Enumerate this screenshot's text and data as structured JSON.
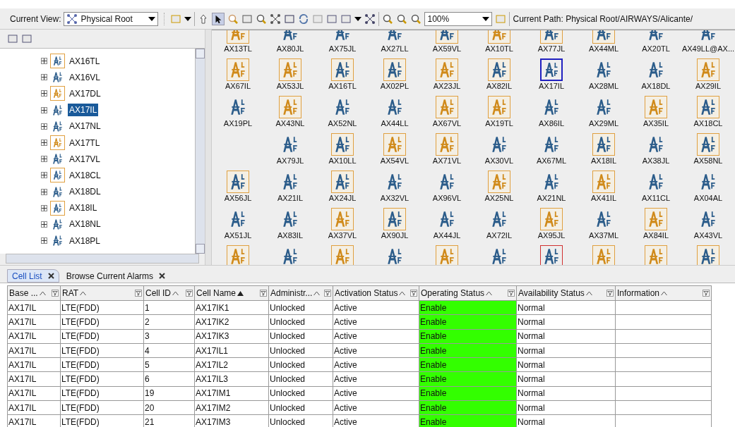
{
  "toolbar": {
    "view_label": "Current View:",
    "view_value": "Physical Root",
    "zoom_value": "100%",
    "path": "Current Path: Physical Root/AIRWAYS/Alicante/"
  },
  "tree": {
    "items": [
      {
        "label": "AX16TL",
        "framed": true,
        "color": "#2b5c8a",
        "selected": false
      },
      {
        "label": "AX16VL",
        "framed": false,
        "color": "#2b5c8a",
        "selected": false
      },
      {
        "label": "AX17DL",
        "framed": true,
        "color": "#d08a1a",
        "selected": false
      },
      {
        "label": "AX17IL",
        "framed": false,
        "color": "#2b5c8a",
        "selected": true
      },
      {
        "label": "AX17NL",
        "framed": false,
        "color": "#2b5c8a",
        "selected": false
      },
      {
        "label": "AX17TL",
        "framed": true,
        "color": "#d08a1a",
        "selected": false
      },
      {
        "label": "AX17VL",
        "framed": false,
        "color": "#2b5c8a",
        "selected": false
      },
      {
        "label": "AX18CL",
        "framed": true,
        "color": "#2b5c8a",
        "selected": false
      },
      {
        "label": "AX18DL",
        "framed": false,
        "color": "#2b5c8a",
        "selected": false
      },
      {
        "label": "AX18IL",
        "framed": true,
        "color": "#2b5c8a",
        "selected": false
      },
      {
        "label": "AX18NL",
        "framed": false,
        "color": "#2b5c8a",
        "selected": false
      },
      {
        "label": "AX18PL",
        "framed": false,
        "color": "#2b5c8a",
        "selected": false
      }
    ]
  },
  "map": {
    "rows": [
      [
        {
          "label": "AX13TL",
          "framed": true,
          "alarm": false,
          "color": "#d08a1a",
          "selected": false
        },
        {
          "label": "AX80JL",
          "framed": false,
          "alarm": false,
          "color": "#2b5c8a",
          "selected": false
        },
        {
          "label": "AX75JL",
          "framed": false,
          "alarm": false,
          "color": "#2b5c8a",
          "selected": false
        },
        {
          "label": "AX27LL",
          "framed": false,
          "alarm": false,
          "color": "#2b5c8a",
          "selected": false
        },
        {
          "label": "AX59VL",
          "framed": true,
          "alarm": false,
          "color": "#2b5c8a",
          "selected": false
        },
        {
          "label": "AX10TL",
          "framed": true,
          "alarm": false,
          "color": "#d08a1a",
          "selected": false
        },
        {
          "label": "AX77JL",
          "framed": true,
          "alarm": false,
          "color": "#2b5c8a",
          "selected": false
        },
        {
          "label": "AX44ML",
          "framed": true,
          "alarm": false,
          "color": "#2b5c8a",
          "selected": false
        },
        {
          "label": "AX20TL",
          "framed": false,
          "alarm": false,
          "color": "#2b5c8a",
          "selected": false
        },
        {
          "label": "AX49LL@AX...",
          "framed": false,
          "alarm": false,
          "color": "#2b5c8a",
          "selected": false
        }
      ],
      [
        {
          "label": "AX67IL",
          "framed": true,
          "alarm": false,
          "color": "#d08a1a",
          "selected": false
        },
        {
          "label": "AX53JL",
          "framed": true,
          "alarm": false,
          "color": "#d08a1a",
          "selected": false
        },
        {
          "label": "AX16TL",
          "framed": true,
          "alarm": false,
          "color": "#2b5c8a",
          "selected": false
        },
        {
          "label": "AX02PL",
          "framed": true,
          "alarm": false,
          "color": "#2b5c8a",
          "selected": false
        },
        {
          "label": "AX23JL",
          "framed": true,
          "alarm": false,
          "color": "#d08a1a",
          "selected": false
        },
        {
          "label": "AX82IL",
          "framed": true,
          "alarm": false,
          "color": "#2b5c8a",
          "selected": false
        },
        {
          "label": "AX17IL",
          "framed": false,
          "alarm": false,
          "color": "#2b5c8a",
          "selected": true
        },
        {
          "label": "AX28ML",
          "framed": false,
          "alarm": false,
          "color": "#2b5c8a",
          "selected": false
        },
        {
          "label": "AX18DL",
          "framed": false,
          "alarm": false,
          "color": "#2b5c8a",
          "selected": false
        },
        {
          "label": "AX29IL",
          "framed": true,
          "alarm": false,
          "color": "#d08a1a",
          "selected": false
        }
      ],
      [
        {
          "label": "AX19PL",
          "framed": false,
          "alarm": false,
          "color": "#2b5c8a",
          "selected": false
        },
        {
          "label": "AX43NL",
          "framed": true,
          "alarm": false,
          "color": "#d08a1a",
          "selected": false
        },
        {
          "label": "AX52NL",
          "framed": false,
          "alarm": false,
          "color": "#2b5c8a",
          "selected": false
        },
        {
          "label": "AX44LL",
          "framed": false,
          "alarm": false,
          "color": "#2b5c8a",
          "selected": false
        },
        {
          "label": "AX67VL",
          "framed": true,
          "alarm": false,
          "color": "#d08a1a",
          "selected": false
        },
        {
          "label": "AX19TL",
          "framed": true,
          "alarm": false,
          "color": "#d08a1a",
          "selected": false
        },
        {
          "label": "AX86IL",
          "framed": false,
          "alarm": false,
          "color": "#2b5c8a",
          "selected": false
        },
        {
          "label": "AX29ML",
          "framed": false,
          "alarm": false,
          "color": "#2b5c8a",
          "selected": false
        },
        {
          "label": "AX35IL",
          "framed": true,
          "alarm": false,
          "color": "#d08a1a",
          "selected": false
        },
        {
          "label": "AX18CL",
          "framed": true,
          "alarm": false,
          "color": "#2b5c8a",
          "selected": false
        }
      ],
      [
        null,
        {
          "label": "AX79JL",
          "framed": false,
          "alarm": false,
          "color": "#2b5c8a",
          "selected": false
        },
        {
          "label": "AX10LL",
          "framed": true,
          "alarm": false,
          "color": "#2b5c8a",
          "selected": false
        },
        {
          "label": "AX54VL",
          "framed": true,
          "alarm": false,
          "color": "#d08a1a",
          "selected": false
        },
        {
          "label": "AX71VL",
          "framed": true,
          "alarm": false,
          "color": "#d08a1a",
          "selected": false
        },
        {
          "label": "AX30VL",
          "framed": false,
          "alarm": false,
          "color": "#2b5c8a",
          "selected": false
        },
        {
          "label": "AX67ML",
          "framed": false,
          "alarm": false,
          "color": "#2b5c8a",
          "selected": false
        },
        {
          "label": "AX18IL",
          "framed": true,
          "alarm": false,
          "color": "#2b5c8a",
          "selected": false
        },
        {
          "label": "AX38JL",
          "framed": false,
          "alarm": false,
          "color": "#2b5c8a",
          "selected": false
        },
        {
          "label": "AX58NL",
          "framed": true,
          "alarm": false,
          "color": "#2b5c8a",
          "selected": false
        }
      ],
      [
        {
          "label": "AX56JL",
          "framed": true,
          "alarm": false,
          "color": "#2b5c8a",
          "selected": false
        },
        {
          "label": "AX21IL",
          "framed": false,
          "alarm": false,
          "color": "#2b5c8a",
          "selected": false
        },
        {
          "label": "AX24JL",
          "framed": true,
          "alarm": false,
          "color": "#2b5c8a",
          "selected": false
        },
        {
          "label": "AX32VL",
          "framed": false,
          "alarm": false,
          "color": "#2b5c8a",
          "selected": false
        },
        {
          "label": "AX96VL",
          "framed": false,
          "alarm": false,
          "color": "#2b5c8a",
          "selected": false
        },
        {
          "label": "AX25NL",
          "framed": true,
          "alarm": false,
          "color": "#d08a1a",
          "selected": false
        },
        {
          "label": "AX21NL",
          "framed": false,
          "alarm": false,
          "color": "#2b5c8a",
          "selected": false
        },
        {
          "label": "AX41IL",
          "framed": true,
          "alarm": false,
          "color": "#d08a1a",
          "selected": false
        },
        {
          "label": "AX11CL",
          "framed": false,
          "alarm": false,
          "color": "#2b5c8a",
          "selected": false
        },
        {
          "label": "AX04AL",
          "framed": false,
          "alarm": false,
          "color": "#2b5c8a",
          "selected": false
        }
      ],
      [
        {
          "label": "AX51JL",
          "framed": false,
          "alarm": false,
          "color": "#2b5c8a",
          "selected": false
        },
        {
          "label": "AX83IL",
          "framed": false,
          "alarm": false,
          "color": "#2b5c8a",
          "selected": false
        },
        {
          "label": "AX37VL",
          "framed": true,
          "alarm": false,
          "color": "#d08a1a",
          "selected": false
        },
        {
          "label": "AX90JL",
          "framed": true,
          "alarm": false,
          "color": "#2b5c8a",
          "selected": false
        },
        {
          "label": "AX44JL",
          "framed": false,
          "alarm": false,
          "color": "#2b5c8a",
          "selected": false
        },
        {
          "label": "AX72IL",
          "framed": false,
          "alarm": false,
          "color": "#2b5c8a",
          "selected": false
        },
        {
          "label": "AX95JL",
          "framed": true,
          "alarm": false,
          "color": "#d08a1a",
          "selected": false
        },
        {
          "label": "AX37ML",
          "framed": false,
          "alarm": false,
          "color": "#2b5c8a",
          "selected": false
        },
        {
          "label": "AX84IL",
          "framed": true,
          "alarm": false,
          "color": "#d08a1a",
          "selected": false
        },
        {
          "label": "AX43VL",
          "framed": false,
          "alarm": false,
          "color": "#2b5c8a",
          "selected": false
        }
      ],
      [
        {
          "framed": true,
          "alarm": false,
          "color": "#d08a1a",
          "selected": false
        },
        {
          "framed": false,
          "alarm": false,
          "color": "#2b5c8a",
          "selected": false
        },
        {
          "framed": true,
          "alarm": false,
          "color": "#d08a1a",
          "selected": false
        },
        {
          "framed": false,
          "alarm": false,
          "color": "#2b5c8a",
          "selected": false
        },
        {
          "framed": true,
          "alarm": false,
          "color": "#d08a1a",
          "selected": false
        },
        {
          "framed": false,
          "alarm": false,
          "color": "#2b5c8a",
          "selected": false
        },
        {
          "framed": false,
          "alarm": true,
          "color": "#2b5c8a",
          "selected": false
        },
        {
          "framed": true,
          "alarm": false,
          "color": "#d08a1a",
          "selected": false
        },
        {
          "framed": true,
          "alarm": false,
          "color": "#d08a1a",
          "selected": false
        },
        {
          "framed": true,
          "alarm": false,
          "color": "#2b5c8a",
          "selected": false
        }
      ]
    ]
  },
  "tabs": [
    {
      "label": "Cell List",
      "selected": true
    },
    {
      "label": "Browse Current Alarms",
      "selected": false
    }
  ],
  "table": {
    "columns": [
      {
        "label": "Base ...",
        "sorted": false
      },
      {
        "label": "RAT",
        "sorted": false
      },
      {
        "label": "Cell ID",
        "sorted": false
      },
      {
        "label": "Cell Name",
        "sorted": true
      },
      {
        "label": "Administr...",
        "sorted": false
      },
      {
        "label": "Activation Status",
        "sorted": false
      },
      {
        "label": "Operating Status",
        "sorted": false
      },
      {
        "label": "Availability Status",
        "sorted": false
      },
      {
        "label": "Information",
        "sorted": false
      }
    ],
    "rows": [
      {
        "cells": [
          "AX17IL",
          "LTE(FDD)",
          "1",
          "AX17IK1",
          "Unlocked",
          "Active",
          "Enable",
          "Normal"
        ],
        "color": "#33ff00"
      },
      {
        "cells": [
          "AX17IL",
          "LTE(FDD)",
          "2",
          "AX17IK2",
          "Unlocked",
          "Active",
          "Enable",
          "Normal"
        ],
        "color": "#33ff00"
      },
      {
        "cells": [
          "AX17IL",
          "LTE(FDD)",
          "3",
          "AX17IK3",
          "Unlocked",
          "Active",
          "Enable",
          "Normal"
        ],
        "color": "#33ff00"
      },
      {
        "cells": [
          "AX17IL",
          "LTE(FDD)",
          "4",
          "AX17IL1",
          "Unlocked",
          "Active",
          "Enable",
          "Normal"
        ],
        "color": "#33ff00"
      },
      {
        "cells": [
          "AX17IL",
          "LTE(FDD)",
          "5",
          "AX17IL2",
          "Unlocked",
          "Active",
          "Enable",
          "Normal"
        ],
        "color": "#33ff00"
      },
      {
        "cells": [
          "AX17IL",
          "LTE(FDD)",
          "6",
          "AX17IL3",
          "Unlocked",
          "Active",
          "Enable",
          "Normal"
        ],
        "color": "#33ff00"
      },
      {
        "cells": [
          "AX17IL",
          "LTE(FDD)",
          "19",
          "AX17IM1",
          "Unlocked",
          "Active",
          "Enable",
          "Normal"
        ],
        "color": "#33ff00"
      },
      {
        "cells": [
          "AX17IL",
          "LTE(FDD)",
          "20",
          "AX17IM2",
          "Unlocked",
          "Active",
          "Enable",
          "Normal"
        ],
        "color": "#33ff00"
      },
      {
        "cells": [
          "AX17IL",
          "LTE(FDD)",
          "21",
          "AX17IM3",
          "Unlocked",
          "Active",
          "Enable",
          "Normal"
        ],
        "color": "#33ff00"
      }
    ]
  }
}
